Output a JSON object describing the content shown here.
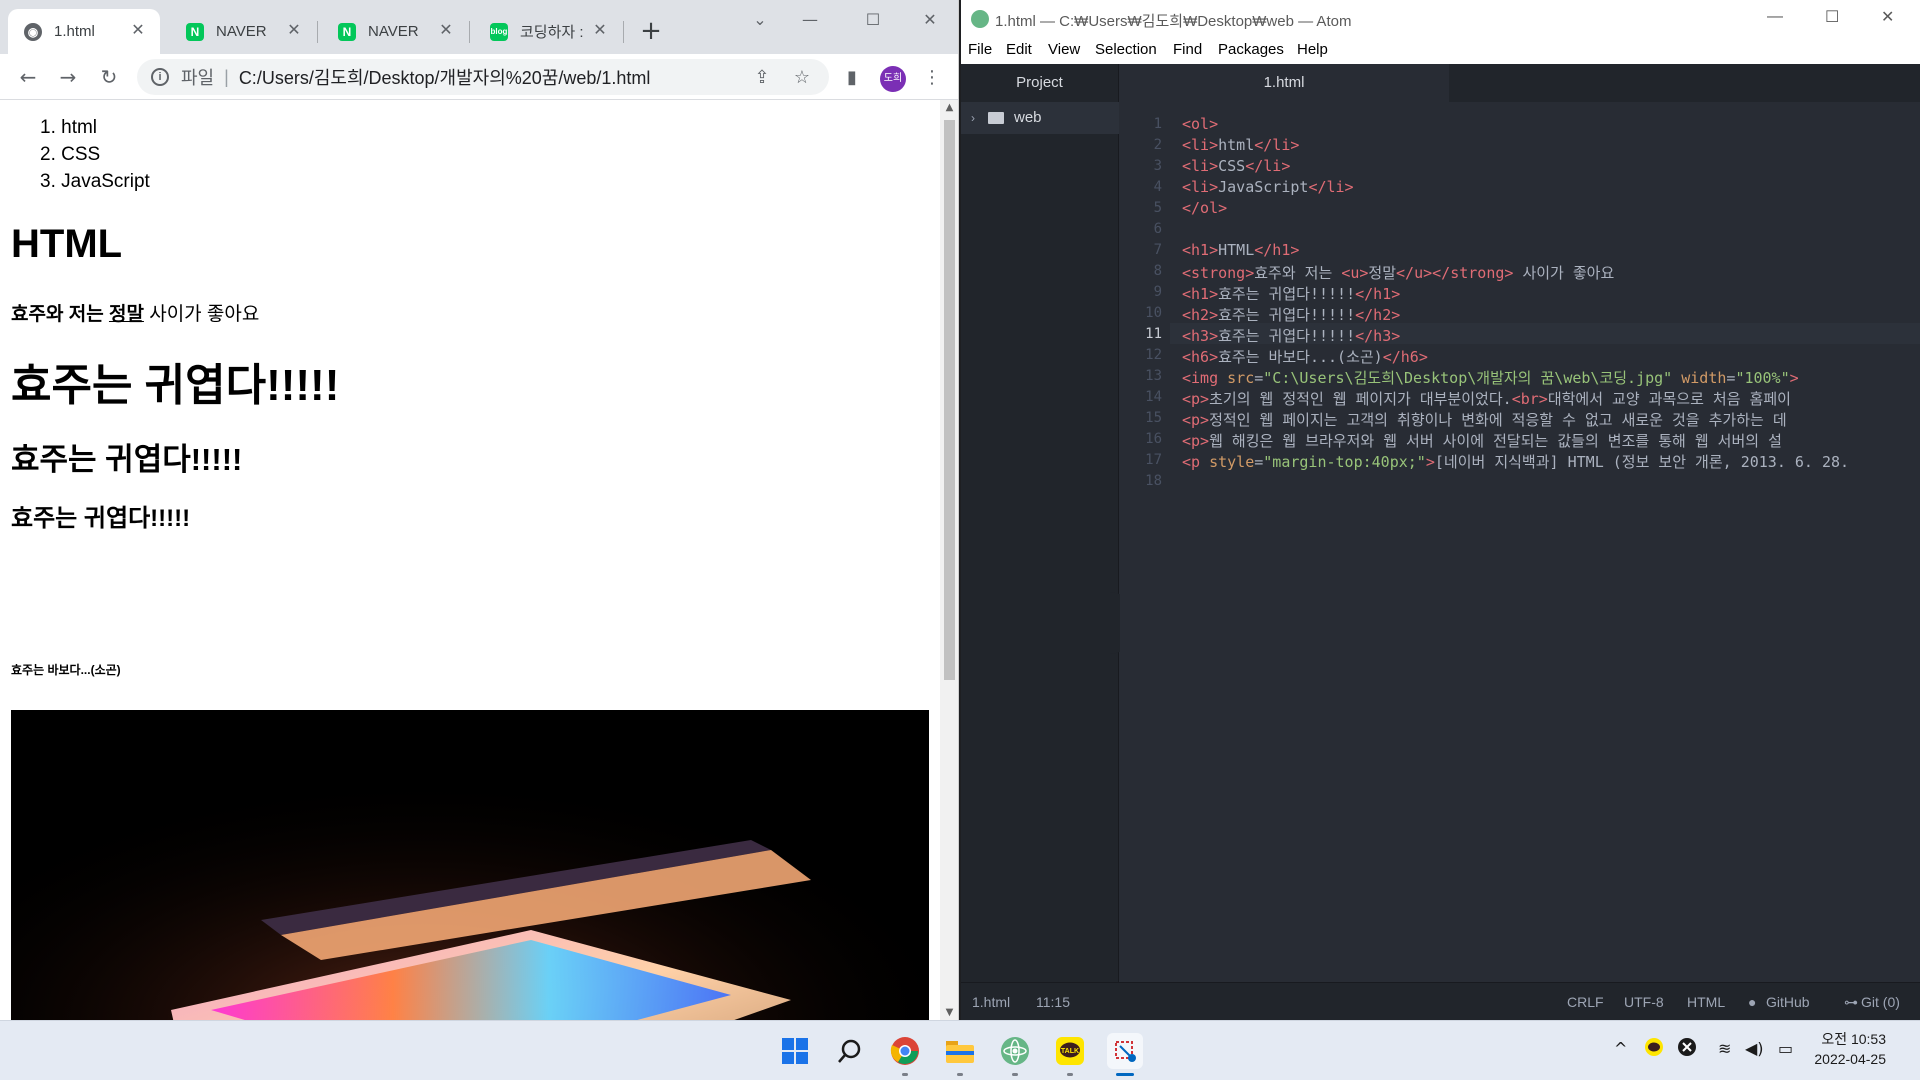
{
  "chrome": {
    "tabs": [
      {
        "title": "1.html",
        "active": true
      },
      {
        "title": "NAVER",
        "active": false
      },
      {
        "title": "NAVER",
        "active": false
      },
      {
        "title": "코딩하자 :",
        "active": false
      }
    ],
    "new_tab": "+",
    "address_label": "파일",
    "address_url": "C:/Users/김도희/Desktop/개발자의%20꿈/web/1.html",
    "profile_initials": "도희"
  },
  "page": {
    "list": [
      "1. html",
      "2. CSS",
      "3. JavaScript"
    ],
    "h1": "HTML",
    "strong_a": "효주와 저는 ",
    "strong_u": "정말",
    "strong_rest": " 사이가 좋아요",
    "h1b": "효주는 귀엽다!!!!!",
    "h2": "효주는 귀엽다!!!!!",
    "h3": "효주는 귀엽다!!!!!",
    "h6": "효주는 바보다...(소곤)"
  },
  "atom": {
    "title": "1.html — C:₩Users₩김도희₩Desktop₩web — Atom",
    "menu": [
      "File",
      "Edit",
      "View",
      "Selection",
      "Find",
      "Packages",
      "Help"
    ],
    "tree_tab": "Project",
    "editor_tab": "1.html",
    "tree_folder": "web",
    "line_numbers": [
      "1",
      "2",
      "3",
      "4",
      "5",
      "6",
      "7",
      "8",
      "9",
      "10",
      "11",
      "12",
      "13",
      "14",
      "15",
      "16",
      "17",
      "18"
    ],
    "current_line": "11",
    "status": {
      "file": "1.html",
      "cursor": "11:15",
      "line_ending": "CRLF",
      "encoding": "UTF-8",
      "grammar": "HTML",
      "github": "GitHub",
      "git": "Git (0)"
    }
  },
  "code_lines": {
    "l1": [
      "<ol>"
    ],
    "l2": [
      "<li>",
      "html",
      "</li>"
    ],
    "l3": [
      "<li>",
      "CSS",
      "</li>"
    ],
    "l4": [
      "<li>",
      "JavaScript",
      "</li>"
    ],
    "l5": [
      "</ol>"
    ],
    "l7": [
      "<h1>",
      "HTML",
      "</h1>"
    ],
    "l8": [
      "<strong>",
      "효주와 저는 ",
      "<u>",
      "정말",
      "</u>",
      "</strong>",
      " 사이가 좋아요"
    ],
    "l9": [
      "<h1>",
      "효주는 귀엽다!!!!!",
      "</h1>"
    ],
    "l10": [
      "<h2>",
      "효주는 귀엽다!!!!!",
      "</h2>"
    ],
    "l11": [
      "<h3>",
      "효주는 귀엽다!!!!!",
      "</h3>"
    ],
    "l12": [
      "<h6>",
      "효주는 바보다...(소곤)",
      "</h6>"
    ],
    "l13": [
      "<img ",
      "src",
      "=",
      "\"C:\\Users\\김도희\\Desktop\\개발자의 꿈\\web\\코딩.jpg\"",
      " width",
      "=",
      "\"100%\"",
      ">"
    ],
    "l14": [
      "<p>",
      "초기의 웹 정적인 웹 페이지가 대부분이었다.",
      "<br>",
      "대학에서 교양 과목으로 처음 홈페이"
    ],
    "l15": [
      "<p>",
      "정적인 웹 페이지는 고객의 취향이나 변화에 적응할 수 없고 새로운 것을 추가하는 데"
    ],
    "l16": [
      "<p>",
      "웹 해킹은 웹 브라우저와 웹 서버 사이에 전달되는 값들의 변조를 통해 웹 서버의 설"
    ],
    "l17": [
      "<p ",
      "style",
      "=",
      "\"margin-top:40px;\"",
      ">",
      "[네이버 지식백과] HTML (정보 보안 개론, 2013. 6. 28."
    ]
  },
  "taskbar": {
    "time": "오전 10:53",
    "date": "2022-04-25",
    "apps": [
      "windows-start",
      "search",
      "chrome",
      "file-explorer",
      "atom",
      "kakaotalk",
      "snipping-tool"
    ]
  },
  "colors": {
    "atom_bg": "#282c34",
    "atom_tag": "#e06c75",
    "atom_attr": "#d19a66",
    "atom_string": "#98c379",
    "chrome_tabbar": "#dee1e6",
    "taskbar_bg": "#e4eaf3"
  }
}
